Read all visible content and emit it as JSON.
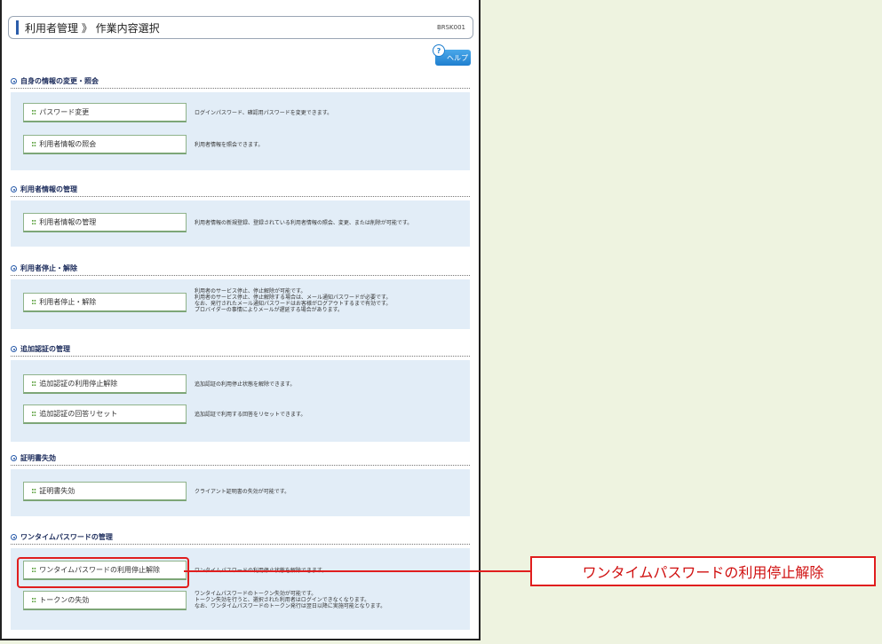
{
  "header": {
    "title": "利用者管理 》 作業内容選択",
    "screen_code": "BRSK001",
    "help_label": "ヘルプ"
  },
  "sections": [
    {
      "title": "自身の情報の変更・照会",
      "rows": [
        {
          "button": "パスワード変更",
          "desc": [
            "ログインパスワード、確認用パスワードを変更できます。"
          ]
        },
        {
          "button": "利用者情報の照会",
          "desc": [
            "利用者情報を照会できます。"
          ]
        }
      ]
    },
    {
      "title": "利用者情報の管理",
      "rows": [
        {
          "button": "利用者情報の管理",
          "desc": [
            "利用者情報の新規登録、登録されている利用者情報の照会、変更、または削除が可能です。"
          ]
        }
      ]
    },
    {
      "title": "利用者停止・解除",
      "rows": [
        {
          "button": "利用者停止・解除",
          "desc": [
            "利用者のサービス停止、停止解除が可能です。",
            "利用者のサービス停止、停止解除する場合は、メール通知パスワードが必要です。",
            "なお、発行されたメール通知パスワードはお客様がログアウトするまで有効です。",
            "プロバイダーの事情によりメールが遅延する場合があります。"
          ]
        }
      ]
    },
    {
      "title": "追加認証の管理",
      "rows": [
        {
          "button": "追加認証の利用停止解除",
          "desc": [
            "追加認証の利用停止状態を解除できます。"
          ]
        },
        {
          "button": "追加認証の回答リセット",
          "desc": [
            "追加認証で利用する回答をリセットできます。"
          ]
        }
      ]
    },
    {
      "title": "証明書失効",
      "rows": [
        {
          "button": "証明書失効",
          "desc": [
            "クライアント証明書の失効が可能です。"
          ]
        }
      ]
    },
    {
      "title": "ワンタイムパスワードの管理",
      "rows": [
        {
          "button": "ワンタイムパスワードの利用停止解除",
          "desc": [
            "ワンタイムパスワードの利用停止状態を解除できます。"
          ]
        },
        {
          "button": "トークンの失効",
          "desc": [
            "ワンタイムパスワードのトークン失効が可能です。",
            "トークン失効を行うと、選択された利用者はログインできなくなります。",
            "なお、ワンタイムパスワードのトークン発行は翌日以降に実施可能となります。"
          ]
        }
      ]
    }
  ],
  "callout": {
    "text": "ワンタイムパスワードの利用停止解除",
    "color": "#e01e1e"
  }
}
